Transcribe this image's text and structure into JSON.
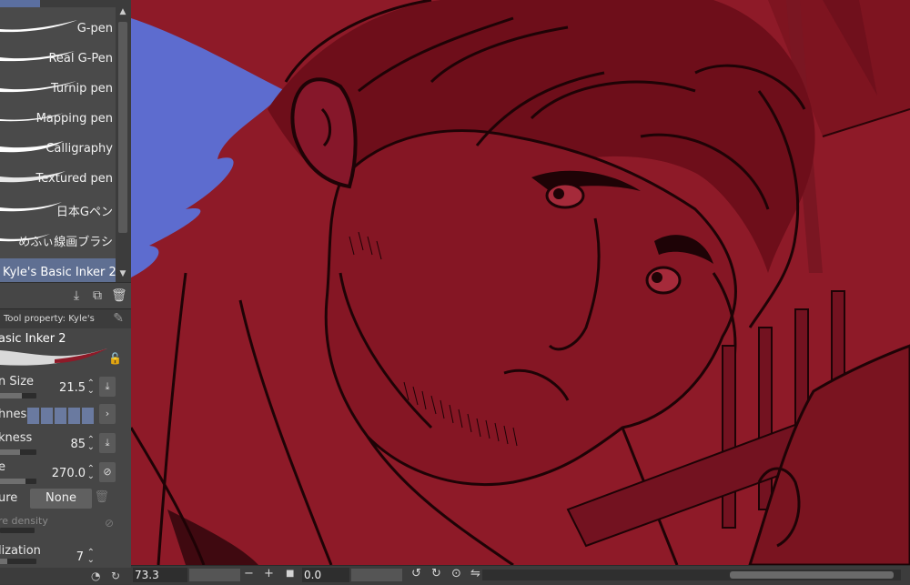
{
  "brush_list": {
    "items": [
      {
        "label": "G-pen"
      },
      {
        "label": "Real G-Pen"
      },
      {
        "label": "Turnip pen"
      },
      {
        "label": "Mapping pen"
      },
      {
        "label": "Calligraphy"
      },
      {
        "label": "Textured pen"
      },
      {
        "label": "日本Gペン"
      },
      {
        "label": "めふぃ線画ブラシ"
      },
      {
        "label": "Kyle's Basic Inker 2"
      }
    ],
    "selected_index": 8
  },
  "tool_property": {
    "header": "Tool property: Kyle's",
    "brush_name": "asic Inker 2",
    "props": {
      "brush_size": {
        "label": "n Size",
        "value": "21.5"
      },
      "hardness": {
        "label": "hness"
      },
      "thickness": {
        "label": "kness",
        "value": "85"
      },
      "direction": {
        "label": "e",
        "value": "270.0"
      },
      "texture": {
        "label": "ure",
        "value": "None"
      },
      "texture_density": {
        "label": "re density"
      },
      "stabilization": {
        "label": "lization",
        "value": "7"
      }
    }
  },
  "status_bar": {
    "zoom": "73.3",
    "rotation": "0.0"
  },
  "colors": {
    "canvas_red": "#8e1a28",
    "canvas_blue": "#5d6ccf",
    "selection": "#5f6f92"
  }
}
